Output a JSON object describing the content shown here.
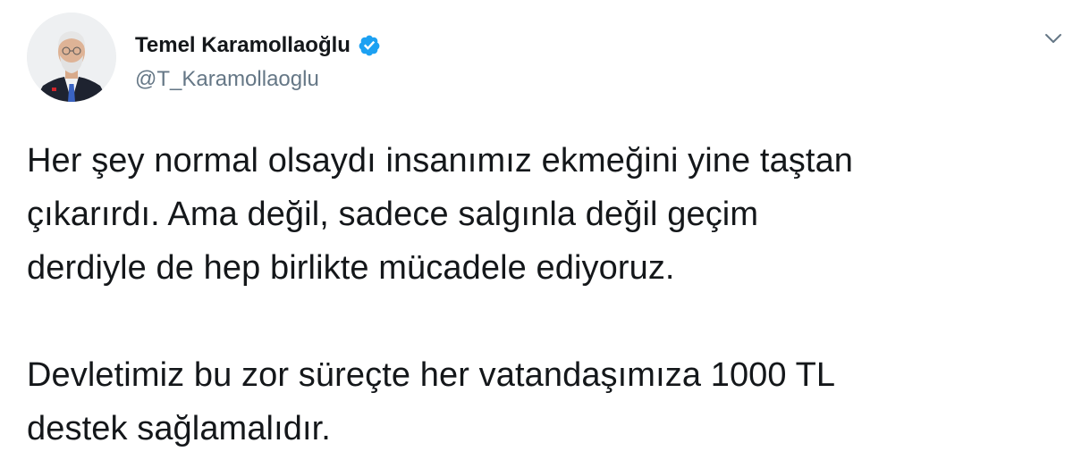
{
  "tweet": {
    "author": {
      "display_name": "Temel Karamollaoğlu",
      "handle": "@T_Karamollaoglu",
      "verified": true,
      "avatar_icon": "profile-photo"
    },
    "menu_icon": "chevron-down-icon",
    "text_paragraphs": [
      "Her şey normal olsaydı insanımız ekmeğini yine taştan\nçıkarırdı. Ama değil, sadece salgınla değil geçim\nderdiyle de hep birlikte mücadele ediyoruz.",
      "Devletimiz bu zor süreçte her vatandaşımıza 1000 TL\ndestek sağlamalıdır."
    ]
  },
  "colors": {
    "text": "#14171a",
    "secondary_text": "#657786",
    "verified_blue": "#1da1f2",
    "background": "#ffffff"
  }
}
